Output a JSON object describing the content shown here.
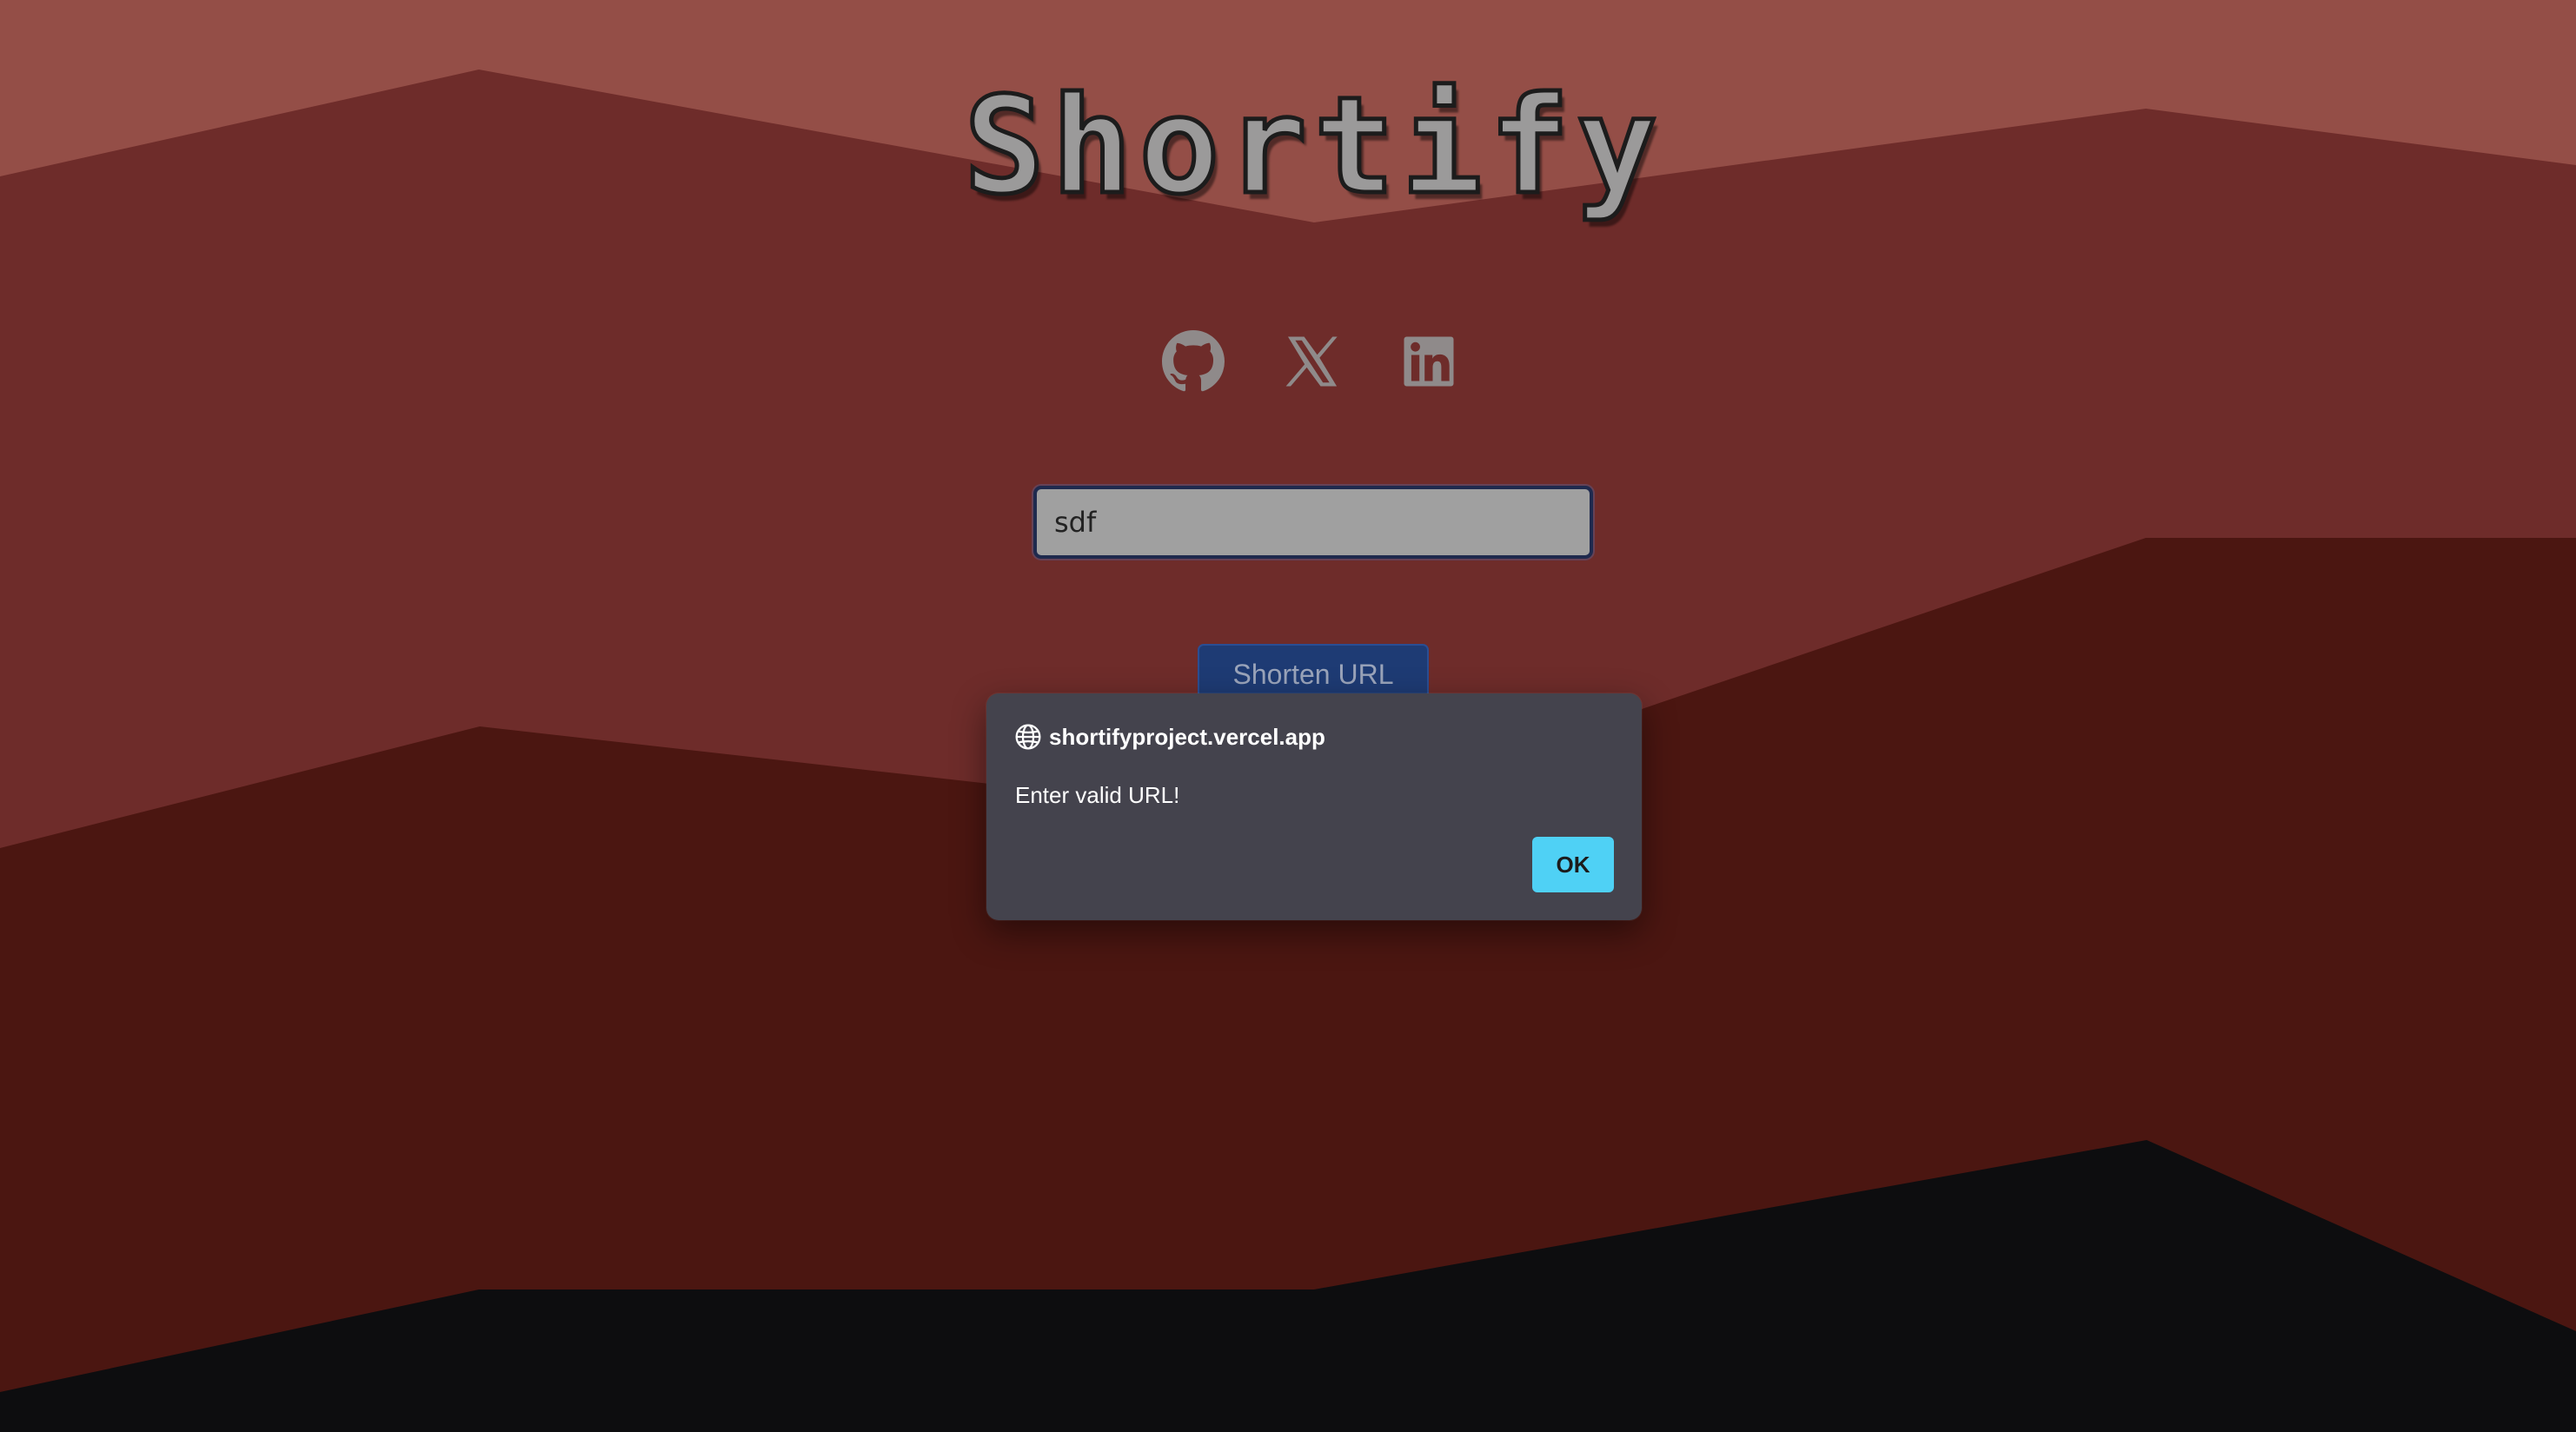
{
  "app": {
    "title": "Shortify"
  },
  "social": [
    {
      "name": "GitHub",
      "icon": "github-icon"
    },
    {
      "name": "X",
      "icon": "x-icon"
    },
    {
      "name": "LinkedIn",
      "icon": "linkedin-icon"
    }
  ],
  "form": {
    "url_value": "sdf",
    "submit_label": "Shorten URL"
  },
  "alert": {
    "origin": "shortifyproject.vercel.app",
    "message": "Enter valid URL!",
    "ok_label": "OK",
    "icon": "globe-icon"
  },
  "colors": {
    "background_top": "#944e47",
    "background_mid": "#6e2c2a",
    "background_deep": "#4b1611",
    "background_bottom": "#0d0d0f",
    "icon_gray": "#8f8a8a",
    "button_blue": "#1e3b74",
    "ok_cyan": "#4fd1f5",
    "dialog_bg": "#44434d"
  }
}
